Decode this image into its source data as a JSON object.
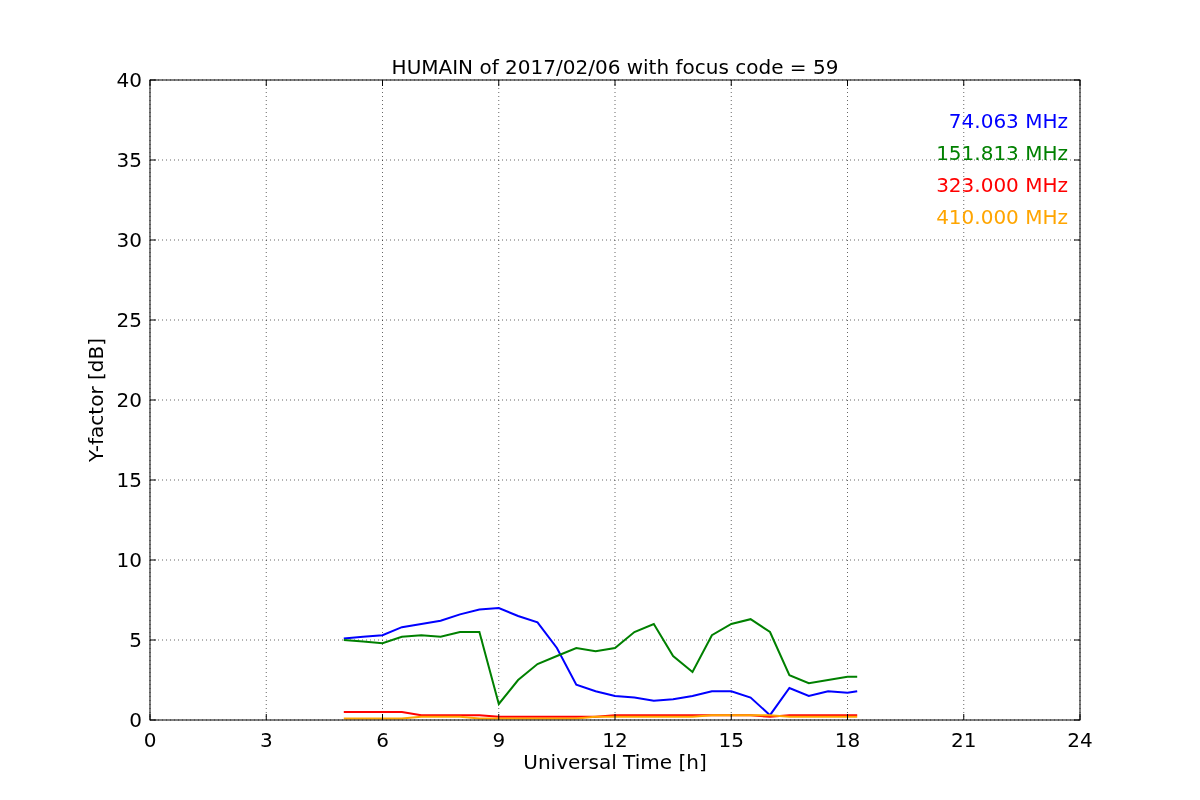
{
  "chart_data": {
    "type": "line",
    "title": "HUMAIN of 2017/02/06 with focus code = 59",
    "xlabel": "Universal Time [h]",
    "ylabel": "Y-factor [dB]",
    "x": [
      5,
      5.5,
      6,
      6.5,
      7,
      7.5,
      8,
      8.5,
      9,
      9.5,
      10,
      10.5,
      11,
      11.5,
      12,
      12.5,
      13,
      13.5,
      14,
      14.5,
      15,
      15.5,
      16,
      16.5,
      17,
      17.5,
      18,
      18.25
    ],
    "grid": true,
    "xlim": [
      0,
      24
    ],
    "ylim": [
      0,
      40
    ],
    "xticks": [
      0,
      3,
      6,
      9,
      12,
      15,
      18,
      21,
      24
    ],
    "yticks": [
      0,
      5,
      10,
      15,
      20,
      25,
      30,
      35,
      40
    ],
    "series": [
      {
        "name": "74.063 MHz",
        "color": "#0000ff",
        "values": [
          5.1,
          5.2,
          5.3,
          5.8,
          6.0,
          6.2,
          6.6,
          6.9,
          7.0,
          6.5,
          6.1,
          4.5,
          2.2,
          1.8,
          1.5,
          1.4,
          1.2,
          1.3,
          1.5,
          1.8,
          1.8,
          1.4,
          0.3,
          2.0,
          1.5,
          1.8,
          1.7,
          1.8
        ]
      },
      {
        "name": "151.813 MHz",
        "color": "#008000",
        "values": [
          5.0,
          4.9,
          4.8,
          5.2,
          5.3,
          5.2,
          5.5,
          5.5,
          1.0,
          2.5,
          3.5,
          4.0,
          4.5,
          4.3,
          4.5,
          5.5,
          6.0,
          4.0,
          3.0,
          5.3,
          6.0,
          6.3,
          5.5,
          2.8,
          2.3,
          2.5,
          2.7,
          2.7
        ]
      },
      {
        "name": "323.000 MHz",
        "color": "#ff0000",
        "values": [
          0.5,
          0.5,
          0.5,
          0.5,
          0.3,
          0.3,
          0.3,
          0.3,
          0.2,
          0.2,
          0.2,
          0.2,
          0.2,
          0.2,
          0.3,
          0.3,
          0.3,
          0.3,
          0.3,
          0.3,
          0.3,
          0.3,
          0.2,
          0.3,
          0.3,
          0.3,
          0.3,
          0.3
        ]
      },
      {
        "name": "410.000 MHz",
        "color": "#ffa500",
        "values": [
          0.1,
          0.1,
          0.1,
          0.1,
          0.2,
          0.2,
          0.2,
          0.1,
          0.1,
          0.1,
          0.1,
          0.1,
          0.1,
          0.2,
          0.2,
          0.2,
          0.2,
          0.2,
          0.2,
          0.3,
          0.3,
          0.3,
          0.3,
          0.2,
          0.2,
          0.2,
          0.2,
          0.2
        ]
      }
    ]
  }
}
